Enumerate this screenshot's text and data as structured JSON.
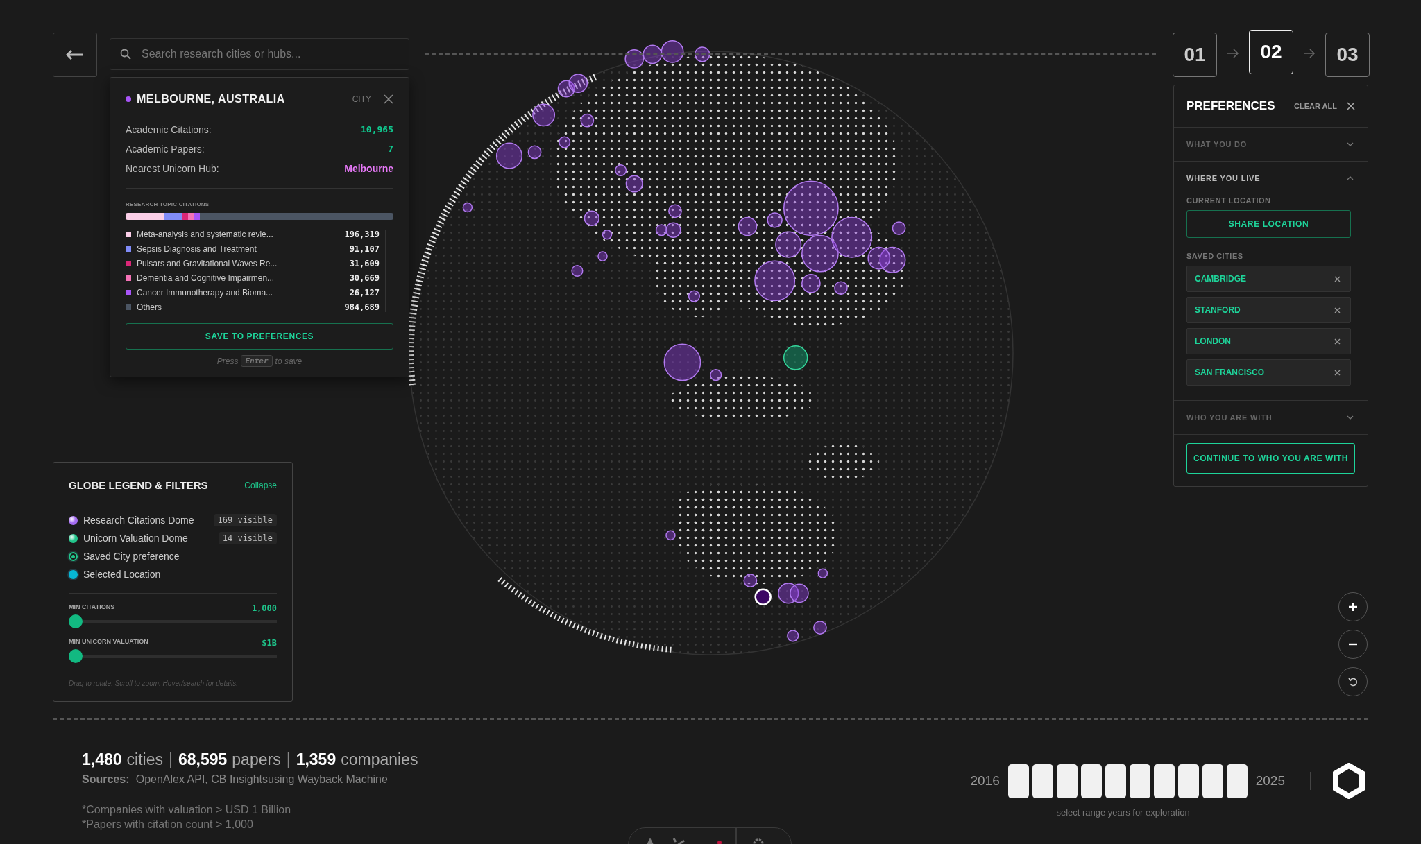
{
  "search": {
    "placeholder": "Search research cities or hubs..."
  },
  "city_card": {
    "title": "MELBOURNE, AUSTRALIA",
    "color": "#a855f7",
    "type": "CITY",
    "stats": [
      {
        "label": "Academic Citations:",
        "value": "10,965",
        "color": "#10c98f"
      },
      {
        "label": "Academic Papers:",
        "value": "7",
        "color": "#10c98f"
      },
      {
        "label": "Nearest Unicorn Hub:",
        "value": "Melbourne",
        "color": "#e879f9"
      }
    ],
    "topics_heading": "RESEARCH TOPIC CITATIONS",
    "topics": [
      {
        "name": "Meta-analysis and systematic revie...",
        "value": "196,319",
        "color": "#fbcfe8"
      },
      {
        "name": "Sepsis Diagnosis and Treatment",
        "value": "91,107",
        "color": "#818cf8"
      },
      {
        "name": "Pulsars and Gravitational Waves Re...",
        "value": "31,609",
        "color": "#db2777"
      },
      {
        "name": "Dementia and Cognitive Impairmen...",
        "value": "30,669",
        "color": "#f472b6"
      },
      {
        "name": "Cancer Immunotherapy and Bioma...",
        "value": "26,127",
        "color": "#a855f7"
      },
      {
        "name": "Others",
        "value": "984,689",
        "color": "#4b5563"
      }
    ],
    "save_button": "SAVE TO PREFERENCES",
    "hint_before": "Press",
    "hint_key": "Enter",
    "hint_after": "to save"
  },
  "steps": [
    {
      "label": "01",
      "selected": false
    },
    {
      "label": "02",
      "selected": true
    },
    {
      "label": "03",
      "selected": false
    }
  ],
  "preferences": {
    "title": "PREFERENCES",
    "clear_all": "CLEAR ALL",
    "sections": [
      {
        "title": "WHAT YOU DO",
        "expanded": false
      },
      {
        "title": "WHERE YOU LIVE",
        "expanded": true,
        "current_location_label": "CURRENT LOCATION",
        "share_button": "SHARE LOCATION",
        "saved_cities_label": "SAVED CITIES",
        "saved_cities": [
          "CAMBRIDGE",
          "STANFORD",
          "LONDON",
          "SAN FRANCISCO"
        ]
      },
      {
        "title": "WHO YOU ARE WITH",
        "expanded": false
      }
    ],
    "continue_button": "CONTINUE TO WHO YOU ARE WITH"
  },
  "legend": {
    "title": "GLOBE LEGEND & FILTERS",
    "collapse": "Collapse",
    "items": [
      {
        "kind": "dome",
        "label": "Research Citations Dome",
        "color": "#a36bf0",
        "count": "169 visible"
      },
      {
        "kind": "dome",
        "label": "Unicorn Valuation Dome",
        "color": "#22c58b",
        "count": "14 visible"
      },
      {
        "kind": "ring",
        "label": "Saved City preference",
        "color": "#22c58b"
      },
      {
        "kind": "selected",
        "label": "Selected Location",
        "color": "#06b6d4"
      }
    ],
    "sliders": [
      {
        "label": "MIN CITATIONS",
        "value": "1,000",
        "level": 0
      },
      {
        "label": "MIN UNICORN VALUATION",
        "value": "$1B",
        "level": 0
      }
    ],
    "hint": "Drag to rotate. Scroll to zoom. Hover/search for details."
  },
  "summary": {
    "separator": "|",
    "counts": [
      {
        "number": "1,480",
        "unit": "cities"
      },
      {
        "number": "68,595",
        "unit": "papers"
      },
      {
        "number": "1,359",
        "unit": "companies"
      }
    ],
    "sources_label": "Sources:",
    "sources": [
      {
        "text": "OpenAlex API",
        "after": ","
      },
      {
        "text": "CB Insights",
        "after": "using"
      },
      {
        "text": "Wayback Machine"
      }
    ],
    "footnotes": [
      "*Companies with valuation > USD 1 Billion",
      "*Papers with citation count > 1,000"
    ]
  },
  "years": {
    "start": "2016",
    "end": "2025",
    "caption": "select range years for exploration",
    "cells": [
      {
        "selected": true
      },
      {
        "selected": true
      },
      {
        "selected": true
      },
      {
        "selected": true
      },
      {
        "selected": true
      },
      {
        "selected": true
      },
      {
        "selected": true
      },
      {
        "selected": true
      },
      {
        "selected": true
      },
      {
        "selected": true
      }
    ]
  }
}
